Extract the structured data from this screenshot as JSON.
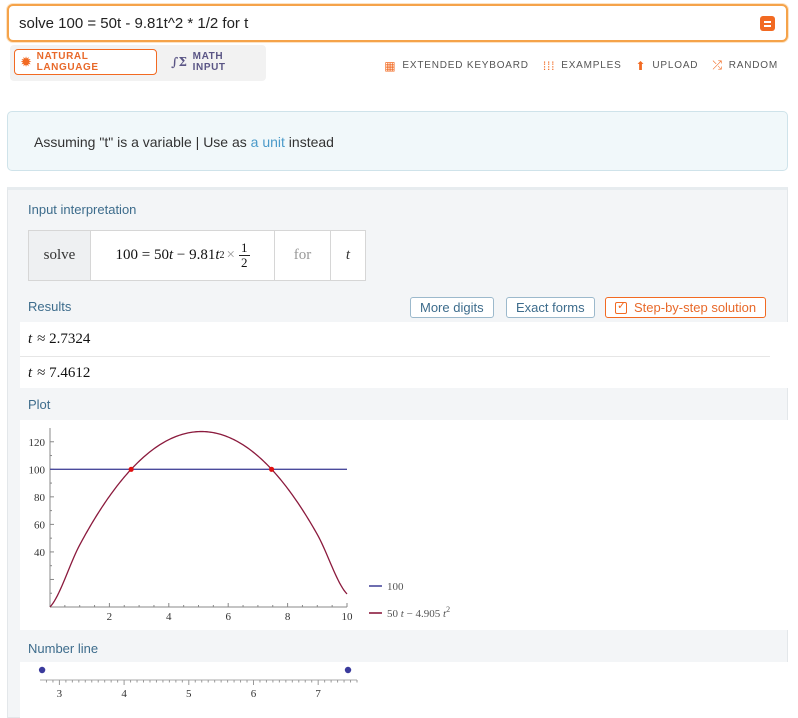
{
  "search": {
    "query": "solve 100 = 50t - 9.81t^2 * 1/2 for t"
  },
  "modes": {
    "natural_language": "NATURAL LANGUAGE",
    "math_input": "MATH INPUT"
  },
  "tools": {
    "extended_keyboard": "EXTENDED KEYBOARD",
    "examples": "EXAMPLES",
    "upload": "UPLOAD",
    "random": "RANDOM"
  },
  "assumption": {
    "prefix": "Assuming \"t\" is a variable | Use as ",
    "link": "a unit",
    "suffix": " instead"
  },
  "input_interpretation": {
    "title": "Input interpretation",
    "solve": "solve",
    "equation_lhs": "100 = 50",
    "equation_t1": "t",
    "equation_mid": " − 9.81",
    "equation_t2": "t",
    "equation_exp": "2",
    "equation_times": "×",
    "frac_num": "1",
    "frac_den": "2",
    "for": "for",
    "var": "t"
  },
  "results": {
    "title": "Results",
    "buttons": {
      "more_digits": "More digits",
      "exact_forms": "Exact forms",
      "step_by_step": "Step-by-step solution"
    },
    "values": [
      {
        "var": "t",
        "approx": "≈",
        "value": "2.7324"
      },
      {
        "var": "t",
        "approx": "≈",
        "value": "7.4612"
      }
    ]
  },
  "plot": {
    "title": "Plot"
  },
  "number_line": {
    "title": "Number line"
  },
  "chart_data": [
    {
      "type": "line",
      "xlim": [
        0,
        10
      ],
      "ylim": [
        0,
        130
      ],
      "x_ticks": [
        "2",
        "4",
        "6",
        "8",
        "10"
      ],
      "y_ticks": [
        "40",
        "60",
        "80",
        "100",
        "120"
      ],
      "series": [
        {
          "name": "100",
          "color": "#4a4a9c",
          "expression": "100",
          "x": [
            0,
            10
          ],
          "y": [
            100,
            100
          ]
        },
        {
          "name": "50 t − 4.905 t²",
          "color": "#8b1a3d",
          "expression": "50t - 4.905t^2",
          "x": [
            0,
            1,
            2,
            3,
            4,
            5,
            6,
            7,
            8,
            9,
            10
          ],
          "y": [
            0,
            45.095,
            80.38,
            105.855,
            121.52,
            127.375,
            123.42,
            109.655,
            86.08,
            52.695,
            9.5
          ]
        }
      ],
      "intersections": [
        {
          "x": 2.7324,
          "y": 100
        },
        {
          "x": 7.4612,
          "y": 100
        }
      ],
      "legend_position": "bottom-right",
      "legend": [
        {
          "label": "100",
          "color": "#4a4a9c"
        },
        {
          "label_prefix": "50",
          "label_var1": "t",
          "label_mid": " − 4.905",
          "label_var2": "t",
          "label_exp": "2",
          "color": "#8b1a3d"
        }
      ]
    },
    {
      "type": "scatter",
      "xlim": [
        2.7,
        7.6
      ],
      "x_ticks": [
        "3",
        "4",
        "5",
        "6",
        "7"
      ],
      "points": [
        2.7324,
        7.4612
      ],
      "point_color": "#3a3a9c"
    }
  ]
}
